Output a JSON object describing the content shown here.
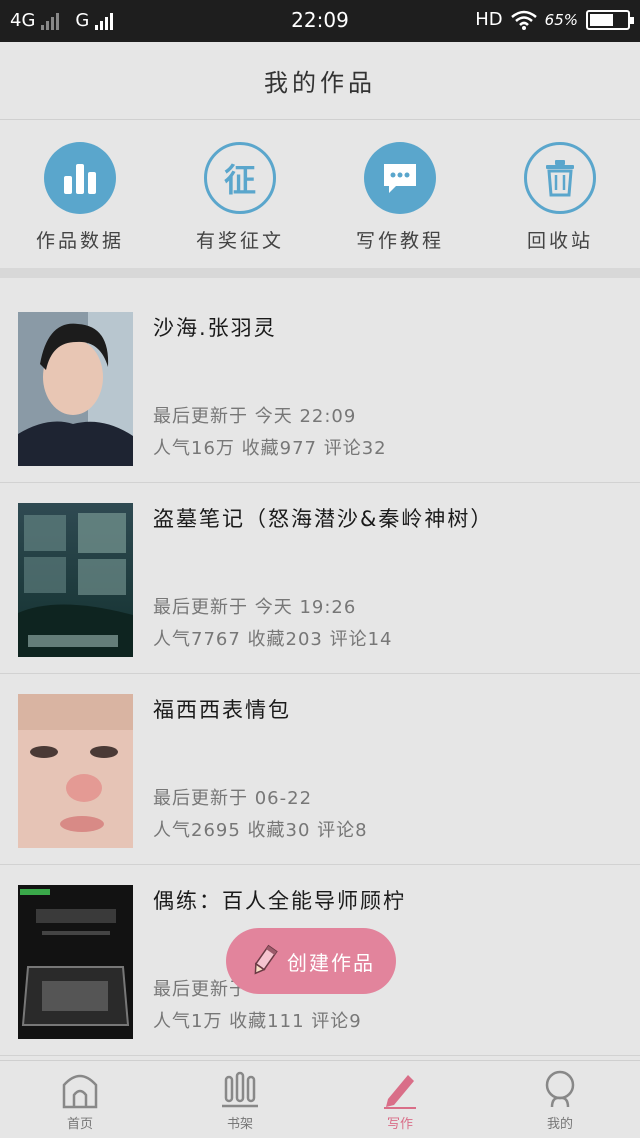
{
  "status": {
    "network1": "4G",
    "network2": "G",
    "time": "22:09",
    "hd": "HD",
    "battery": "65%",
    "battery_level": 0.65
  },
  "header": {
    "title": "我的作品"
  },
  "shortcuts": [
    {
      "label": "作品数据",
      "icon": "bar-chart-icon"
    },
    {
      "label": "有奖征文",
      "icon": "zheng-badge-icon",
      "glyph": "征"
    },
    {
      "label": "写作教程",
      "icon": "chat-bubble-icon"
    },
    {
      "label": "回收站",
      "icon": "trash-icon"
    }
  ],
  "works": [
    {
      "title": "沙海.张羽灵",
      "updated": "最后更新于 今天 22:09",
      "stats": "人气16万 收藏977 评论32"
    },
    {
      "title": "盗墓笔记（怒海潜沙&秦岭神树）",
      "updated": "最后更新于 今天 19:26",
      "stats": "人气7767 收藏203 评论14"
    },
    {
      "title": "福西西表情包",
      "updated": "最后更新于 06-22",
      "stats": "人气2695 收藏30 评论8"
    },
    {
      "title": "偶练：百人全能导师顾柠",
      "updated": "最后更新于",
      "stats": "人气1万 收藏111 评论9"
    }
  ],
  "fab": {
    "label": "创建作品"
  },
  "tabs": [
    {
      "label": "首页",
      "icon": "home-icon"
    },
    {
      "label": "书架",
      "icon": "bookshelf-icon"
    },
    {
      "label": "写作",
      "icon": "pen-icon",
      "active": true
    },
    {
      "label": "我的",
      "icon": "profile-icon"
    }
  ],
  "colors": {
    "accent": "#d96e88",
    "icon_blue": "#5aa6cc"
  }
}
